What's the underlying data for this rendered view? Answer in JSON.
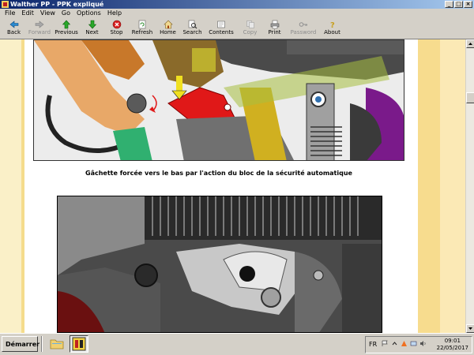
{
  "window": {
    "title": "Walther PP - PPK expliqué",
    "controls": [
      "minimize",
      "maximize",
      "close"
    ]
  },
  "menu": [
    "File",
    "Edit",
    "View",
    "Go",
    "Options",
    "Help"
  ],
  "toolbar": {
    "buttons": [
      {
        "label": "Back",
        "icon": "back-arrow-icon",
        "enabled": true
      },
      {
        "label": "Forward",
        "icon": "forward-arrow-icon",
        "enabled": false
      },
      {
        "label": "Previous",
        "icon": "up-arrow-icon",
        "enabled": true
      },
      {
        "label": "Next",
        "icon": "down-arrow-icon",
        "enabled": true
      },
      {
        "label": "Stop",
        "icon": "stop-icon",
        "enabled": true
      },
      {
        "label": "Refresh",
        "icon": "refresh-icon",
        "enabled": true
      },
      {
        "label": "Home",
        "icon": "home-icon",
        "enabled": true
      },
      {
        "label": "Search",
        "icon": "search-icon",
        "enabled": true
      },
      {
        "label": "Contents",
        "icon": "contents-icon",
        "enabled": true
      },
      {
        "label": "Copy",
        "icon": "copy-icon",
        "enabled": false
      },
      {
        "label": "Print",
        "icon": "print-icon",
        "enabled": true
      },
      {
        "label": "Password",
        "icon": "key-icon",
        "enabled": false
      },
      {
        "label": "About",
        "icon": "about-icon",
        "enabled": true
      }
    ]
  },
  "page": {
    "caption": "Gâchette forcée vers le bas par l'action du bloc de la sécurité automatique"
  },
  "colors": {
    "page_stripe_left": "#faf0c8",
    "page_stripe_right": "#f7dc8e",
    "diagram_red": "#e01818",
    "diagram_orange": "#e0a060",
    "diagram_green": "#80b020",
    "diagram_purple": "#7a1a8a"
  },
  "taskbar": {
    "start_label": "Démarrer",
    "language": "FR",
    "time": "09:01",
    "date": "22/05/2017"
  }
}
